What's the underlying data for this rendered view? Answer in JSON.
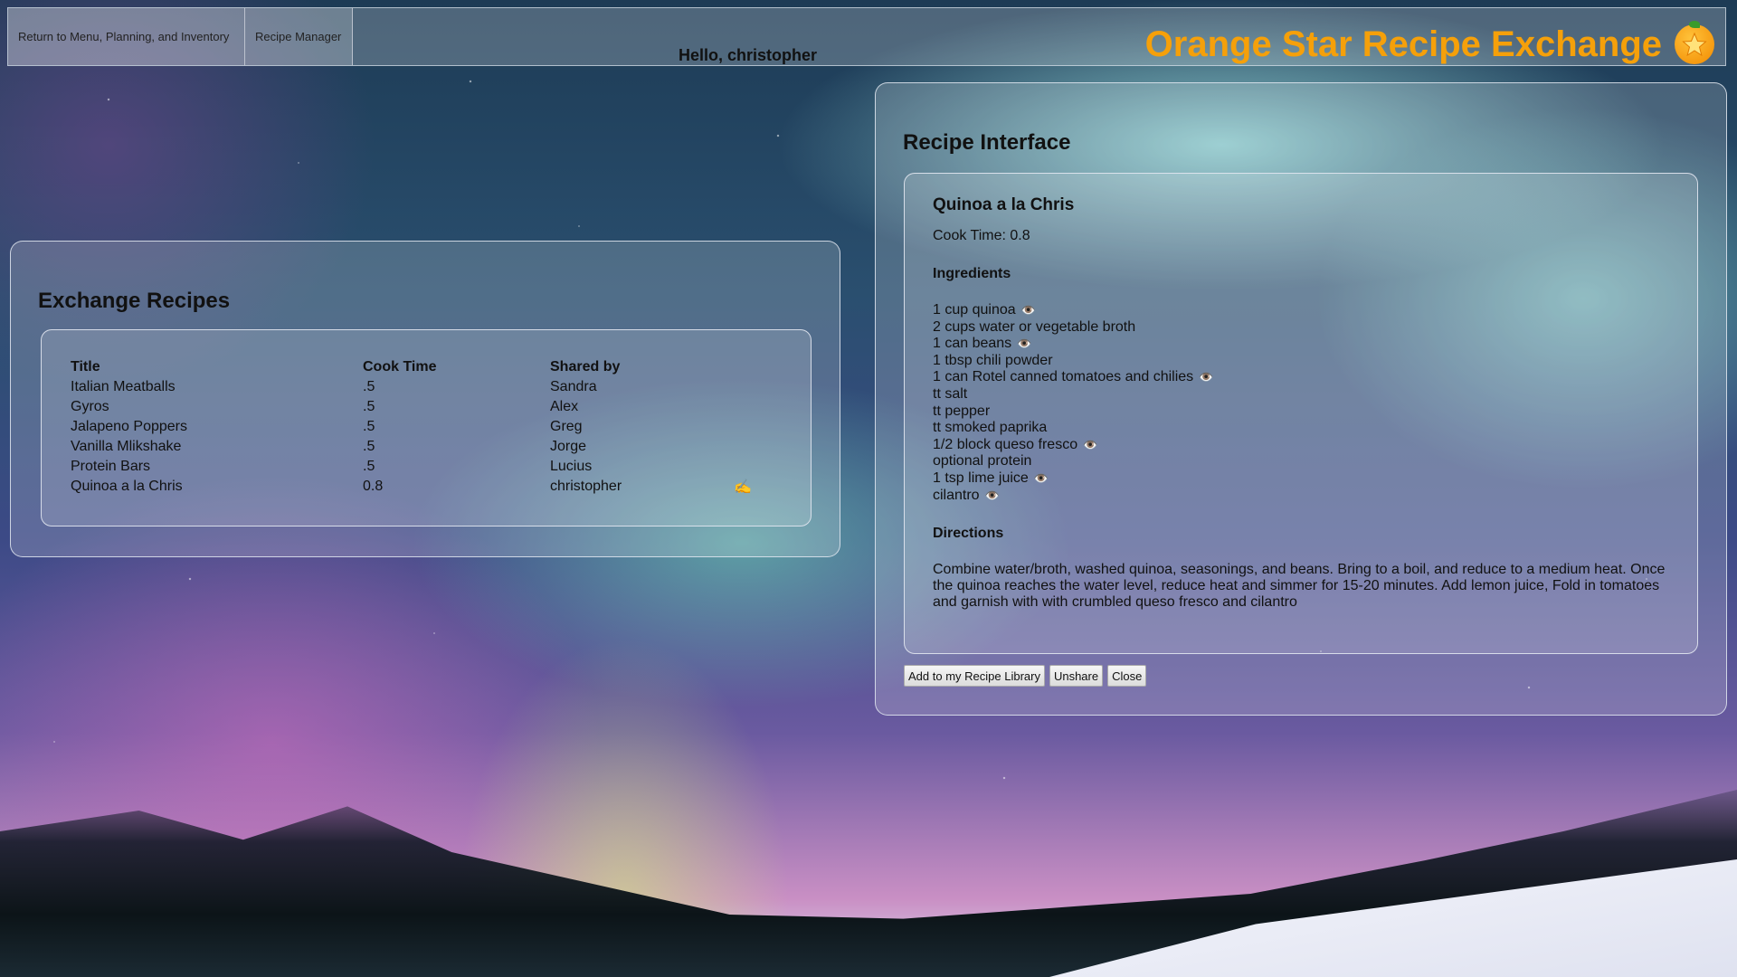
{
  "nav": {
    "menu_label": "Return to Menu, Planning, and Inventory",
    "manager_label": "Recipe Manager"
  },
  "greeting": "Hello, christopher",
  "brand": {
    "title": "Orange Star Recipe Exchange",
    "logo_icon": "orange-star-logo-icon",
    "color": "#f5a00a"
  },
  "exchange": {
    "title": "Exchange Recipes",
    "columns": [
      "Title",
      "Cook Time",
      "Shared by"
    ],
    "rows": [
      {
        "title": "Italian Meatballs",
        "cook_time": ".5",
        "shared_by": "Sandra"
      },
      {
        "title": "Gyros",
        "cook_time": ".5",
        "shared_by": "Alex"
      },
      {
        "title": "Jalapeno Poppers",
        "cook_time": ".5",
        "shared_by": "Greg"
      },
      {
        "title": "Vanilla Mlikshake",
        "cook_time": ".5",
        "shared_by": "Jorge"
      },
      {
        "title": "Protein Bars",
        "cook_time": ".5",
        "shared_by": "Lucius"
      },
      {
        "title": "Quinoa a la Chris",
        "cook_time": "0.8",
        "shared_by": "christopher",
        "edit_icon": "✍️"
      }
    ]
  },
  "recipe": {
    "panel_title": "Recipe Interface",
    "name": "Quinoa a la Chris",
    "cook_time": "Cook Time: 0.8",
    "ingredients_heading": "Ingredients",
    "ingredients": [
      {
        "text": "1 cup quinoa",
        "eye": true
      },
      {
        "text": "2 cups water or vegetable broth",
        "eye": false
      },
      {
        "text": "1 can beans",
        "eye": true
      },
      {
        "text": "1 tbsp chili powder",
        "eye": false
      },
      {
        "text": "1 can Rotel canned tomatoes and chilies",
        "eye": true
      },
      {
        "text": "tt salt",
        "eye": false
      },
      {
        "text": "tt pepper",
        "eye": false
      },
      {
        "text": "tt smoked paprika",
        "eye": false
      },
      {
        "text": "1/2 block queso fresco",
        "eye": true
      },
      {
        "text": "optional protein",
        "eye": false
      },
      {
        "text": "1 tsp lime juice",
        "eye": true
      },
      {
        "text": "cilantro",
        "eye": true
      }
    ],
    "eye_icon": "👁️",
    "directions_heading": "Directions",
    "directions": "Combine water/broth, washed quinoa, seasonings, and beans. Bring to a boil, and reduce to a medium heat. Once the quinoa reaches the water level, reduce heat and simmer for 15-20 minutes. Add lemon juice, Fold in tomatoes and garnish with with crumbled queso fresco and cilantro",
    "buttons": {
      "add": "Add to my Recipe Library",
      "unshare": "Unshare",
      "close": "Close"
    }
  }
}
